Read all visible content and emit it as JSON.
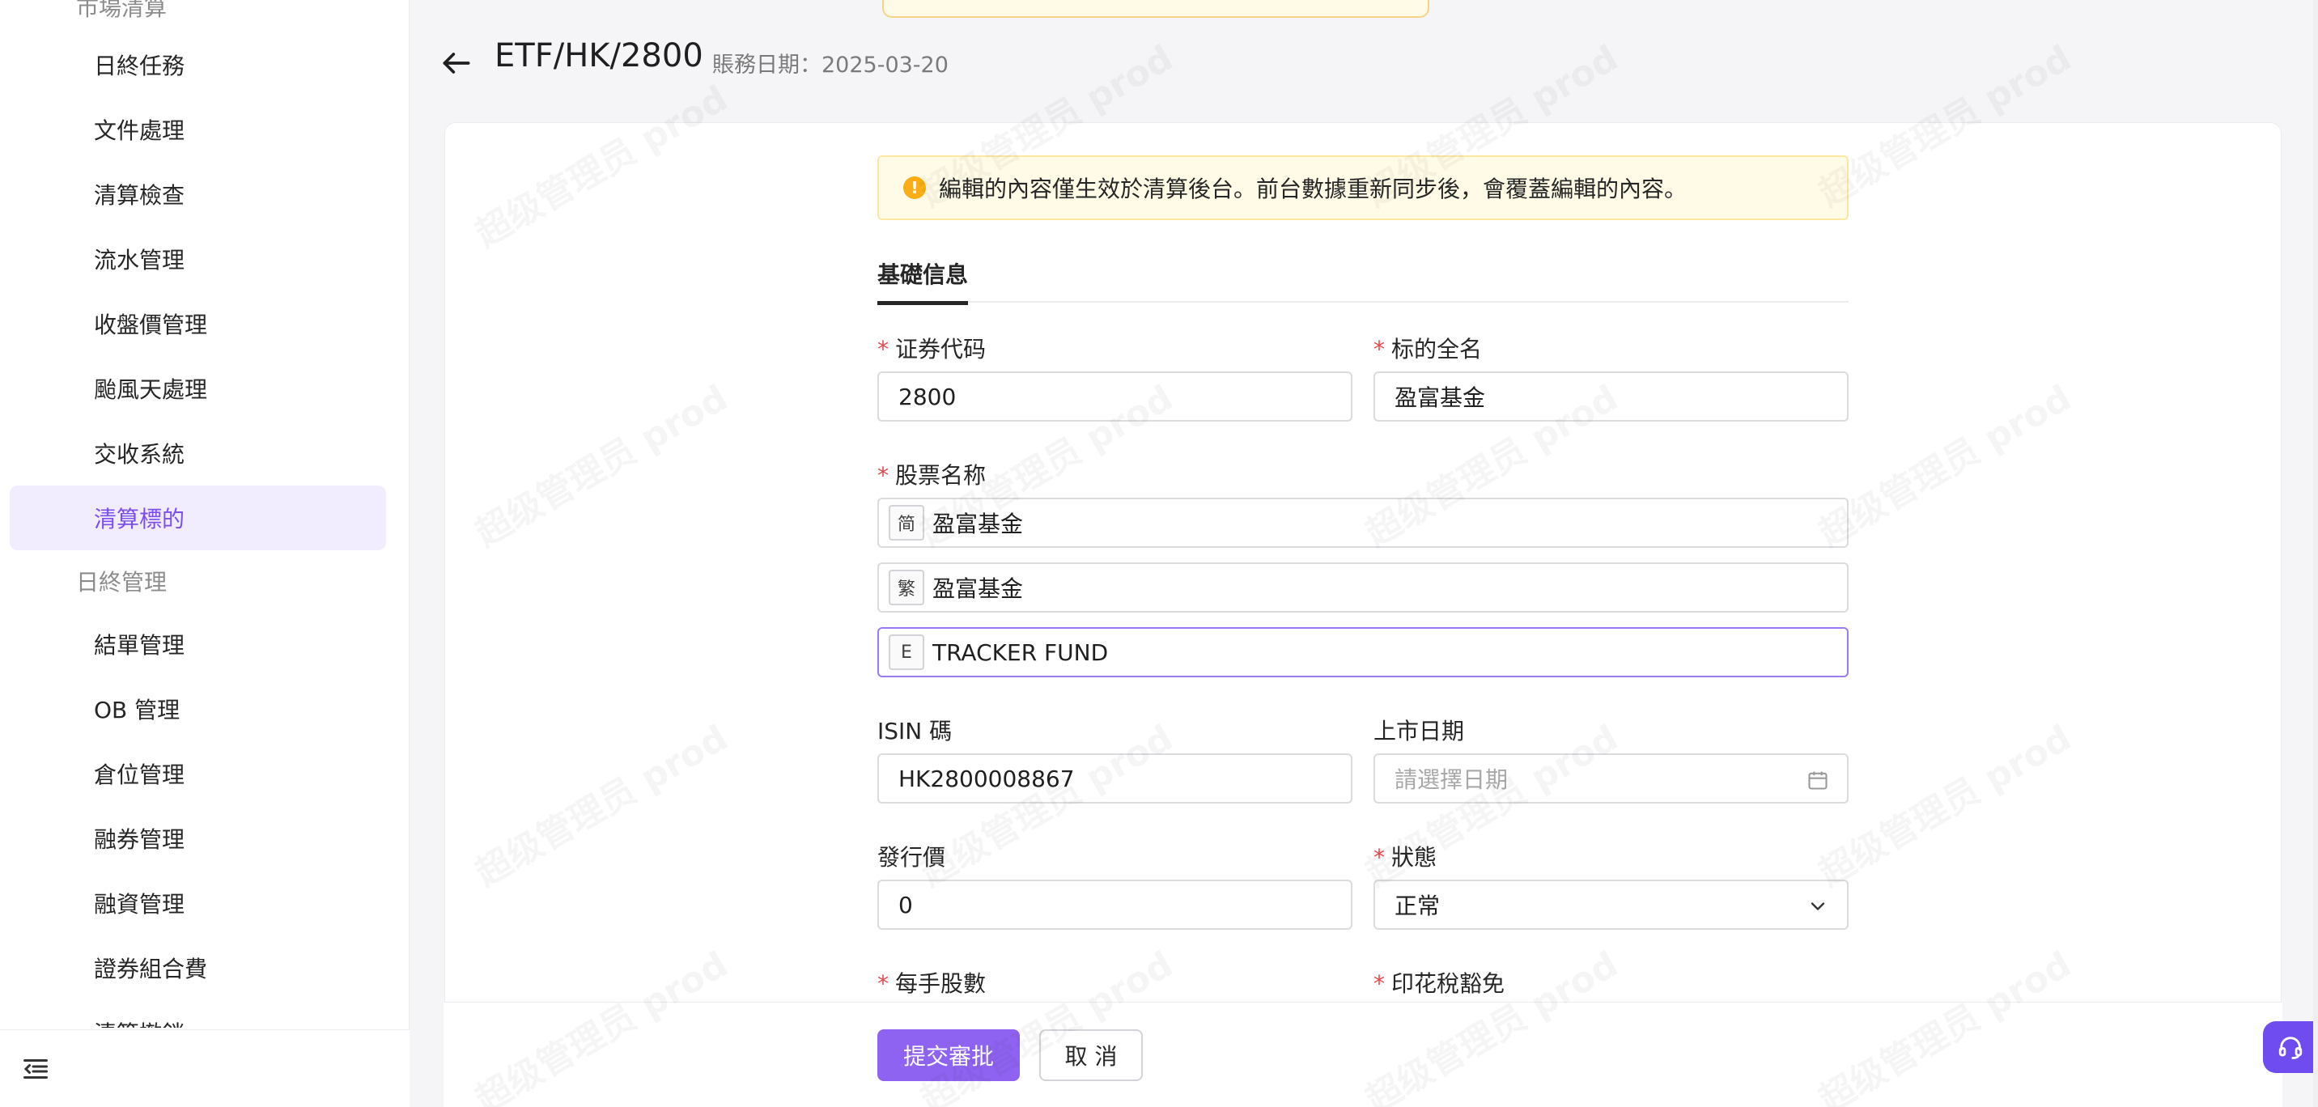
{
  "sidebar": {
    "top_group_label": "市場清算",
    "items": [
      {
        "label": "日終任務"
      },
      {
        "label": "文件處理"
      },
      {
        "label": "清算檢查"
      },
      {
        "label": "流水管理"
      },
      {
        "label": "收盤價管理"
      },
      {
        "label": "颱風天處理"
      },
      {
        "label": "交收系統"
      },
      {
        "label": "清算標的",
        "active": true
      }
    ],
    "group2_label": "日終管理",
    "items2": [
      {
        "label": "結單管理"
      },
      {
        "label": "OB 管理"
      },
      {
        "label": "倉位管理"
      },
      {
        "label": "融券管理"
      },
      {
        "label": "融資管理"
      },
      {
        "label": "證券組合費"
      },
      {
        "label": "清算撤銷"
      }
    ]
  },
  "header": {
    "title": "ETF/HK/2800",
    "date_label": "賬務日期：2025-03-20"
  },
  "alert": {
    "text": "編輯的內容僅生效於清算後台。前台數據重新同步後，會覆蓋編輯的內容。"
  },
  "tabs": [
    {
      "label": "基礎信息"
    }
  ],
  "form": {
    "security_code": {
      "label": "证券代码",
      "value": "2800",
      "required": true
    },
    "full_name": {
      "label": "标的全名",
      "value": "盈富基金",
      "required": true
    },
    "stock_name": {
      "label": "股票名称",
      "required": true,
      "simplified": {
        "tag": "简",
        "value": "盈富基金"
      },
      "traditional": {
        "tag": "繁",
        "value": "盈富基金"
      },
      "english": {
        "tag": "E",
        "value": "TRACKER FUND"
      }
    },
    "isin": {
      "label": "ISIN 碼",
      "value": "HK2800008867"
    },
    "listing_date": {
      "label": "上市日期",
      "placeholder": "請選擇日期"
    },
    "issue_price": {
      "label": "發行價",
      "value": "0"
    },
    "status": {
      "label": "狀態",
      "value": "正常",
      "required": true
    },
    "lot_size": {
      "label": "每手股數",
      "required": true
    },
    "stamp_duty": {
      "label": "印花稅豁免",
      "required": true
    }
  },
  "footer": {
    "submit_label": "提交審批",
    "cancel_label": "取 消"
  },
  "watermark_text": "超级管理员 prod",
  "colors": {
    "accent": "#8f63f2",
    "active_bg": "#f2ecff",
    "active_text": "#7b4ff0",
    "required": "#e5484d",
    "alert_bg": "#fffbe6",
    "alert_icon": "#faad14"
  }
}
